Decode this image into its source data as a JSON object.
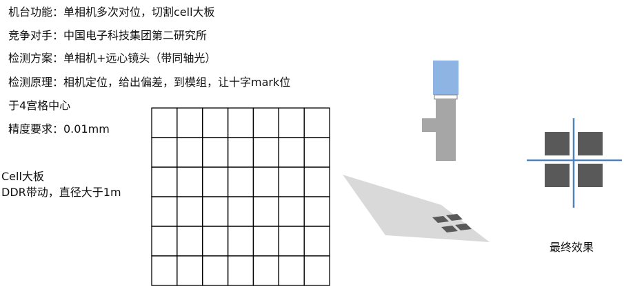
{
  "spec_lines": [
    "机台功能：单相机多次对位，切割cell大板",
    "竞争对手：中国电子科技集团第二研究所",
    "检测方案：单相机+远心镜头（带同轴光）",
    "检测原理：相机定位，给出偏差，到模组，让十字mark位",
    "于4宫格中心",
    "精度要求：0.01mm"
  ],
  "cell_note": [
    "Cell大板",
    "DDR带动，直径大于1m"
  ],
  "result_caption": "最终效果",
  "grid": {
    "rows": 6,
    "cols": 7
  },
  "colors": {
    "text": "#111111",
    "grid_line": "#000000",
    "camera_body": "#8db4e2",
    "lens_gray": "#a6a6a6",
    "plate": "#d9d9d9",
    "mark_square": "#595959",
    "crosshair": "#4f81bd"
  }
}
